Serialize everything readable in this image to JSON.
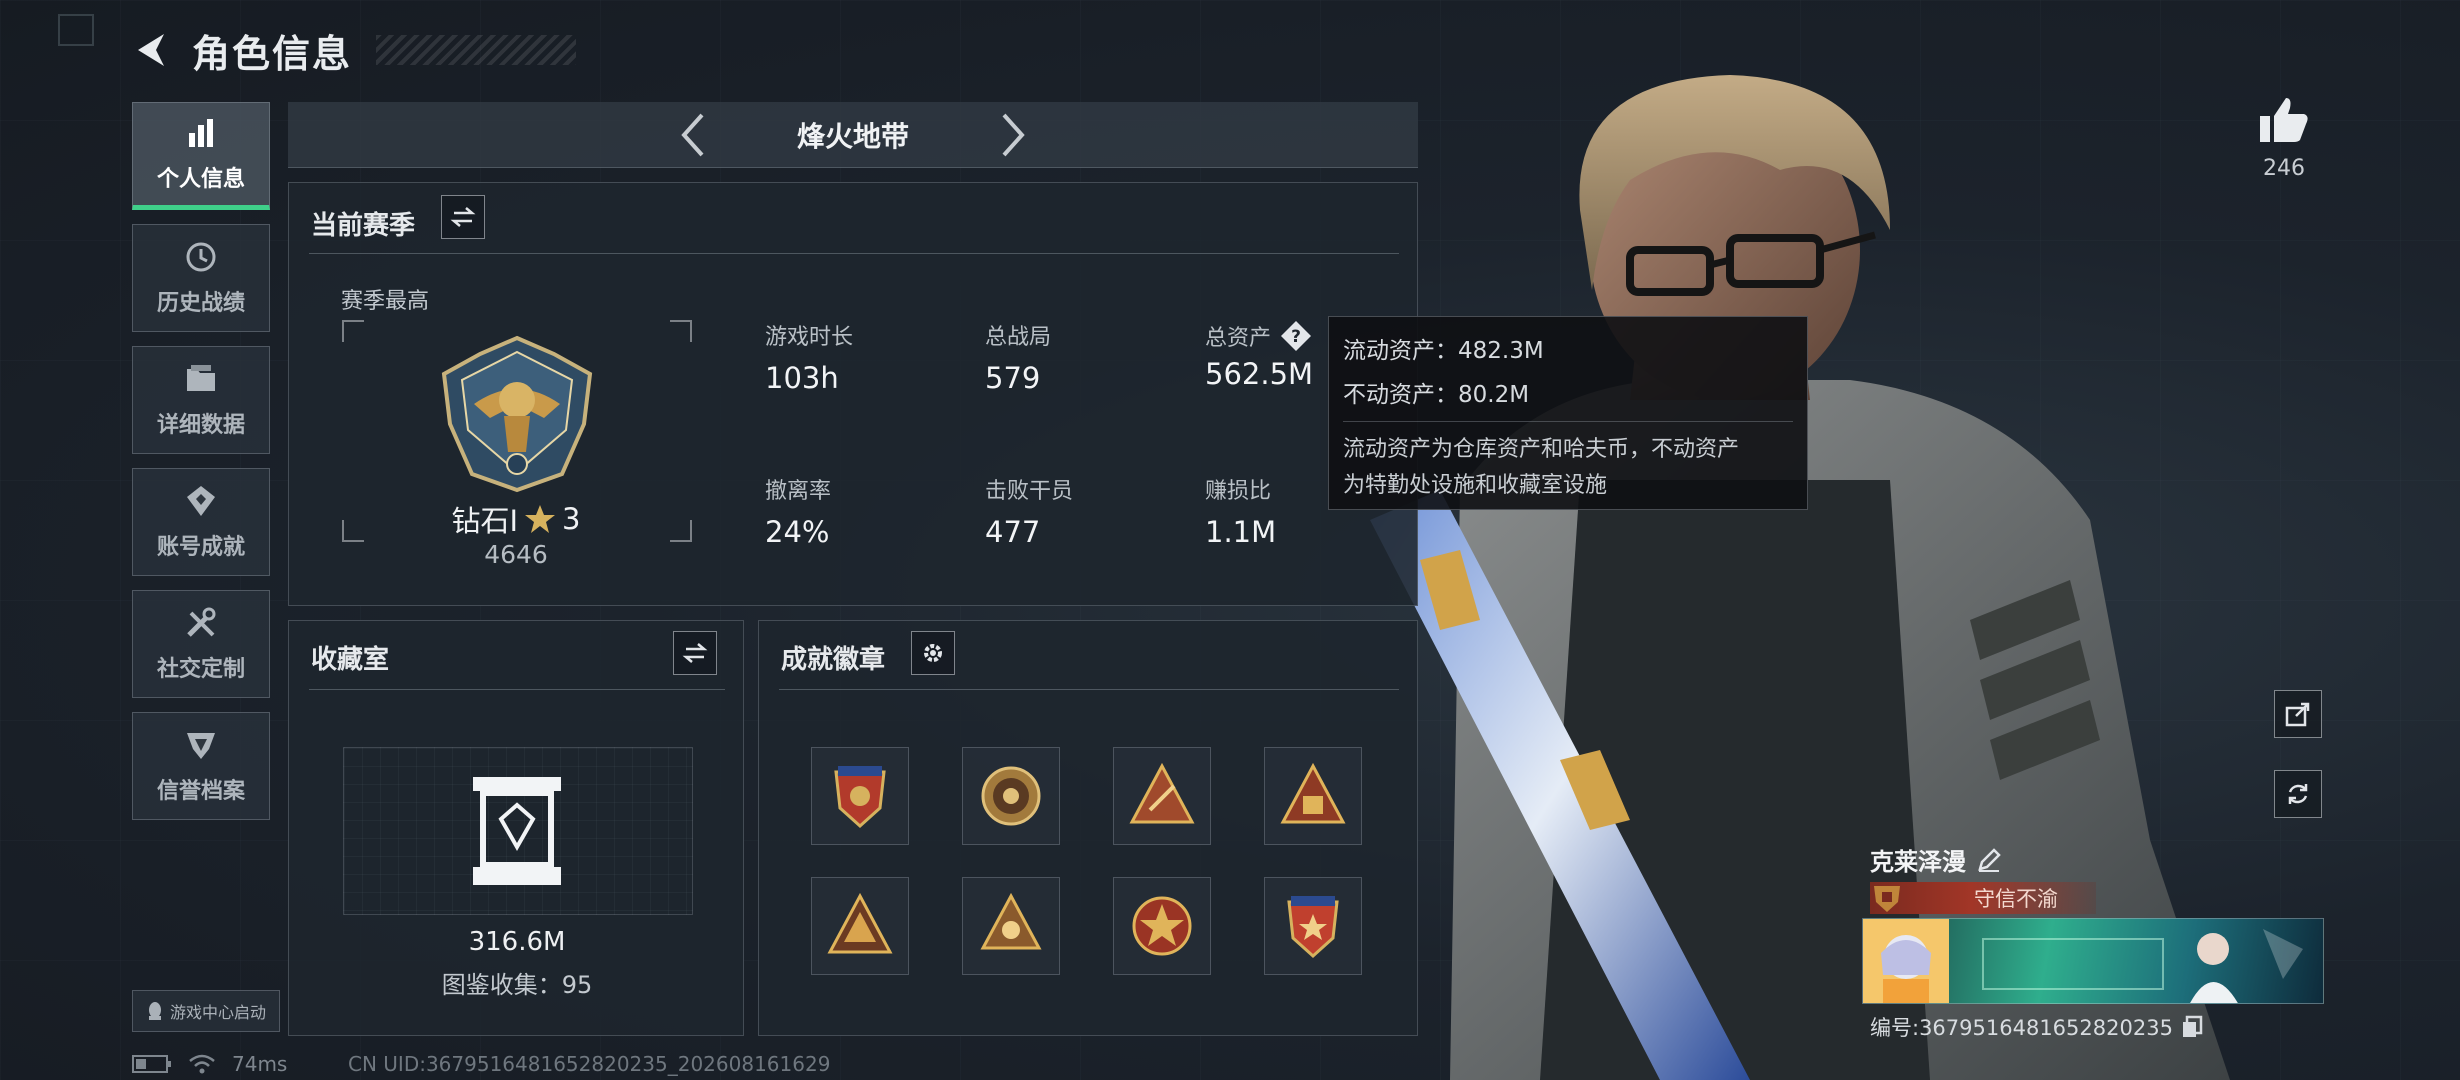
{
  "header": {
    "title": "角色信息"
  },
  "sidebar": {
    "items": [
      {
        "label": "个人信息",
        "icon": "bar-chart-icon",
        "active": true
      },
      {
        "label": "历史战绩",
        "icon": "history-icon"
      },
      {
        "label": "详细数据",
        "icon": "folder-icon"
      },
      {
        "label": "账号成就",
        "icon": "achievement-icon"
      },
      {
        "label": "社交定制",
        "icon": "tools-icon"
      },
      {
        "label": "信誉档案",
        "icon": "shield-icon"
      }
    ],
    "game_center": "游戏中心启动"
  },
  "mode": {
    "title": "烽火地带"
  },
  "season": {
    "title": "当前赛季",
    "best_label": "赛季最高",
    "rank_name": "钻石Ⅰ",
    "rank_stars": "3",
    "rank_points": "4646",
    "stats": [
      {
        "label": "游戏时长",
        "value": "103h"
      },
      {
        "label": "总战局",
        "value": "579"
      },
      {
        "label": "总资产",
        "value": "562.5M"
      },
      {
        "label": "撤离率",
        "value": "24%"
      },
      {
        "label": "击败干员",
        "value": "477"
      },
      {
        "label": "赚损比",
        "value": "1.1M"
      }
    ]
  },
  "tooltip": {
    "liquid": "流动资产：482.3M",
    "fixed": "不动资产：80.2M",
    "desc_line1": "流动资产为仓库资产和哈夫币，不动资产",
    "desc_line2": "为特勤处设施和收藏室设施"
  },
  "collection": {
    "title": "收藏室",
    "value": "316.6M",
    "codex": "图鉴收集：95"
  },
  "badges": {
    "title": "成就徽章",
    "items": [
      "badge-1",
      "badge-2",
      "badge-3",
      "badge-4",
      "badge-5",
      "badge-6",
      "badge-7",
      "badge-8"
    ]
  },
  "profile": {
    "likes": "246",
    "name": "克莱泽漫",
    "title_badge": "守信不渝",
    "id_line": "编号:3679516481652820235"
  },
  "status": {
    "ping": "74ms",
    "uid": "CN UID:3679516481652820235_202608161629"
  },
  "colors": {
    "accent": "#3fd08a",
    "badge_red": "#a23627",
    "gold": "#c99a4a"
  }
}
